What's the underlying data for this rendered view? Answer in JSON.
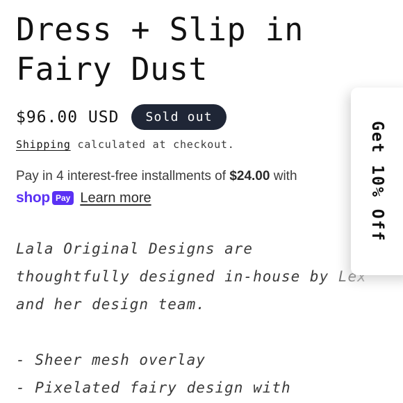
{
  "product": {
    "title_line1": "Dress + Slip in",
    "title_line2": "Fairy Dust",
    "price": "$96.00 USD",
    "status_badge": "Sold out"
  },
  "shipping": {
    "link_label": "Shipping",
    "rest": " calculated at checkout."
  },
  "installments": {
    "prefix": "Pay in 4 interest-free installments of ",
    "amount": "$24.00",
    "suffix": " with",
    "shop_word": "shop",
    "pay_word": "Pay",
    "learn_more": "Learn more"
  },
  "description": {
    "lines": [
      "Lala Original Designs are",
      "thoughtfully designed in-house by Lex",
      "and her design team.",
      "",
      "- Sheer mesh overlay",
      "- Pixelated fairy design with"
    ]
  },
  "promo_tab": {
    "label": "Get 10% Off"
  },
  "colors": {
    "badge_bg": "#1f2636",
    "shop_pay_purple": "#5a31f4",
    "text": "#121212"
  }
}
